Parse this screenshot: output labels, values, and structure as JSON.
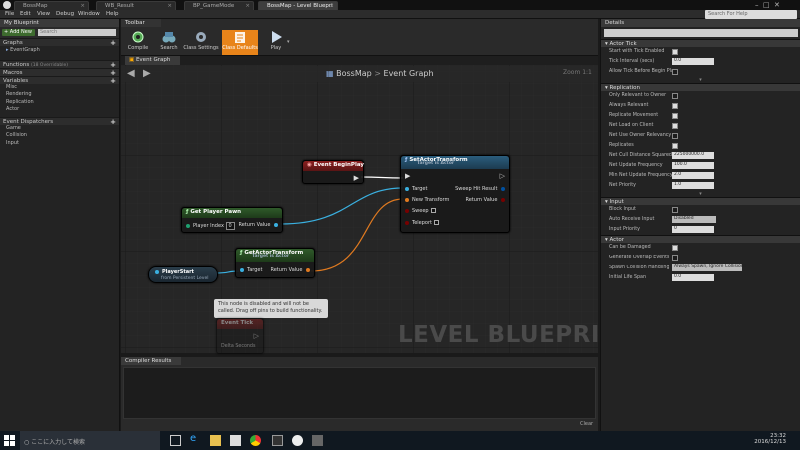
{
  "tabs": [
    "BossMap",
    "WB_Result",
    "BP_GameMode",
    "BossMap - Level Bluepri"
  ],
  "menu": [
    "File",
    "Edit",
    "View",
    "Debug",
    "Window",
    "Help"
  ],
  "search_help": "Search For Help",
  "left": {
    "title": "My Blueprint",
    "add_new": "+ Add New",
    "search_placeholder": "Search",
    "graphs_label": "Graphs",
    "event_graph": "EventGraph",
    "functions_label": "Functions",
    "functions_count": "(18 Overridable)",
    "macros_label": "Macros",
    "variables_label": "Variables",
    "variables": [
      "Misc",
      "Rendering",
      "Replication",
      "Actor"
    ],
    "dispatchers_label": "Event Dispatchers",
    "dispatchers": [
      "Game",
      "Collision",
      "Input"
    ]
  },
  "toolbar": {
    "title": "Toolbar",
    "buttons": [
      "Compile",
      "Search",
      "Class Settings",
      "Class Defaults",
      "Play"
    ]
  },
  "graph": {
    "tab": "Event Graph",
    "breadcrumb_root": "BossMap",
    "breadcrumb_sep": ">",
    "breadcrumb_leaf": "Event Graph",
    "zoom": "Zoom 1:1",
    "watermark": "LEVEL BLUEPRINT",
    "begin_play": "Event BeginPlay",
    "set_title": "SetActorTransform",
    "set_sub": "Target is Actor",
    "set_target": "Target",
    "set_new_transform": "New Transform",
    "set_sweep": "Sweep",
    "set_teleport": "Teleport",
    "set_sweep_hit": "Sweep Hit Result",
    "set_return": "Return Value",
    "gpp_title": "Get Player Pawn",
    "gpp_index": "Player Index",
    "gpp_index_val": "0",
    "gpp_return": "Return Value",
    "gat_title": "GetActorTransform",
    "gat_sub": "Target is Actor",
    "gat_target": "Target",
    "gat_return": "Return Value",
    "ps_title": "PlayerStart",
    "ps_sub": "from Persistent Level",
    "disabled_note": "This node is disabled and will not be called. Drag off pins to build functionality.",
    "tick_title": "Event Tick",
    "tick_delta": "Delta Seconds"
  },
  "compile": {
    "title": "Compiler Results",
    "clear": "Clear"
  },
  "details": {
    "title": "Details",
    "search_placeholder": "Search Details",
    "s_tick": "Actor Tick",
    "tick": [
      [
        "Start with Tick Enabled",
        "on"
      ],
      [
        "Tick Interval (secs)",
        "0.0"
      ],
      [
        "Allow Tick Before Begin Play",
        "off"
      ]
    ],
    "s_repl": "Replication",
    "repl": [
      [
        "Only Relevant to Owner",
        "off"
      ],
      [
        "Always Relevant",
        "on"
      ],
      [
        "Replicate Movement",
        "on"
      ],
      [
        "Net Load on Client",
        "on"
      ],
      [
        "Net Use Owner Relevancy",
        "off"
      ],
      [
        "Replicates",
        "on"
      ],
      [
        "Net Cull Distance Squared",
        "225000000.0"
      ],
      [
        "Net Update Frequency",
        "100.0"
      ],
      [
        "Min Net Update Frequency",
        "2.0"
      ],
      [
        "Net Priority",
        "1.0"
      ]
    ],
    "s_input": "Input",
    "input": [
      [
        "Block Input",
        "off"
      ],
      [
        "Auto Receive Input",
        "Disabled"
      ],
      [
        "Input Priority",
        "0"
      ]
    ],
    "s_actor": "Actor",
    "actor": [
      [
        "Can be Damaged",
        "on"
      ],
      [
        "Generate Overlap Events During Level Streaming",
        "off"
      ],
      [
        "Spawn Collision Handling Method",
        "Always Spawn, Ignore Collisions"
      ],
      [
        "Initial Life Span",
        "0.0"
      ]
    ]
  },
  "taskbar": {
    "search": "ここに入力して検索",
    "time": "23:32",
    "date": "2016/12/13"
  }
}
